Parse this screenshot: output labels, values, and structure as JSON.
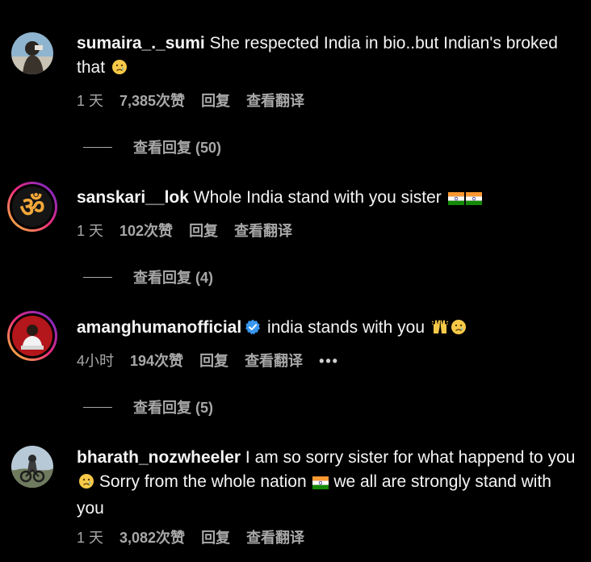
{
  "theme": {
    "background": "#000000",
    "text": "#f5f5f5",
    "secondary_text": "#a8a8a8",
    "verified_blue": "#3897f0"
  },
  "comments": [
    {
      "username": "sumaira_._sumi",
      "text": "She respected India in bio..but Indian's broked that",
      "emojis": [
        "crying-face"
      ],
      "time": "1 天",
      "likes": "7,385次赞",
      "reply_label": "回复",
      "translate_label": "查看翻译",
      "view_replies": "查看回复 (50)"
    },
    {
      "username": "sanskari__lok",
      "text": "Whole India stand with you sister",
      "emojis": [
        "india-flag",
        "india-flag"
      ],
      "time": "1 天",
      "likes": "102次赞",
      "reply_label": "回复",
      "translate_label": "查看翻译",
      "view_replies": "查看回复 (4)"
    },
    {
      "username": "amanghumanofficial",
      "verified": true,
      "text": "india stands with you",
      "emojis": [
        "raising-hands",
        "crying-face"
      ],
      "time": "4小时",
      "likes": "194次赞",
      "reply_label": "回复",
      "translate_label": "查看翻译",
      "more_label": "•••",
      "view_replies": "查看回复 (5)"
    },
    {
      "username": "bharath_nozwheeler",
      "text_part1": "I am so sorry sister for what happend to you",
      "text_part2": "Sorry from the whole nation",
      "text_part3": "we all are strongly stand with you",
      "emojis": [
        "crying-face",
        "india-flag"
      ],
      "time": "1 天",
      "likes": "3,082次赞",
      "reply_label": "回复",
      "translate_label": "查看翻译"
    }
  ]
}
